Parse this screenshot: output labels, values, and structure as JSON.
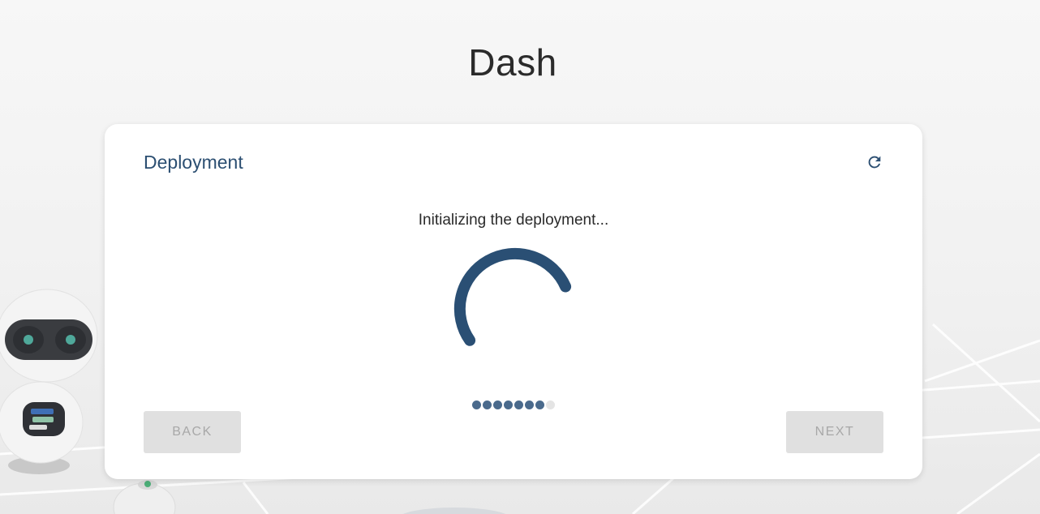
{
  "app": {
    "title": "Dash"
  },
  "card": {
    "title": "Deployment",
    "status": "Initializing the deployment...",
    "refresh_icon": "refresh-icon"
  },
  "spinner": {
    "icon": "loading-spinner"
  },
  "stepper": {
    "total_steps": 8,
    "completed_steps": 7
  },
  "buttons": {
    "back_label": "BACK",
    "next_label": "NEXT"
  },
  "colors": {
    "accent": "#2c4f72",
    "spinner": "#2a4f74",
    "dot_active": "#4a6a8c",
    "dot_inactive": "#e4e4e4",
    "button_bg": "#e0e0e0",
    "button_text": "#a8a8a8"
  }
}
